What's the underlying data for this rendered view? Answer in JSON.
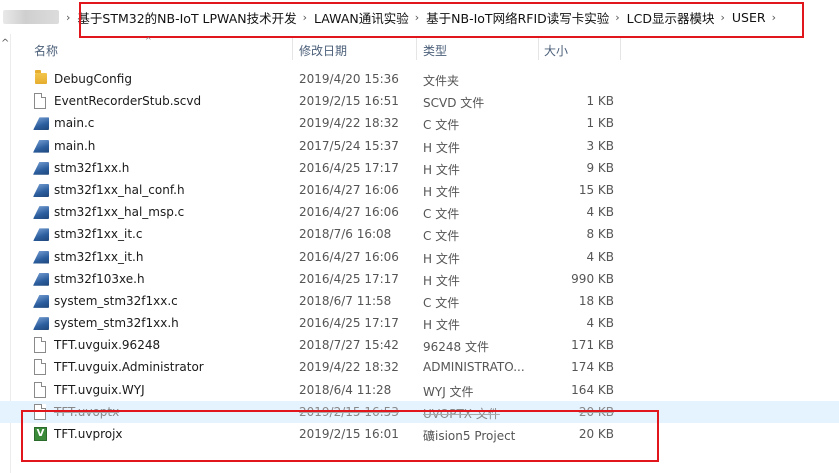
{
  "breadcrumb": {
    "items": [
      "基于STM32的NB-IoT LPWAN技术开发",
      "LAWAN通讯实验",
      "基于NB-IoT网络RFID读写卡实验",
      "LCD显示器模块",
      "USER"
    ],
    "separator": "›"
  },
  "columns": {
    "name": "名称",
    "date": "修改日期",
    "type": "类型",
    "size": "大小"
  },
  "files": [
    {
      "name": "DebugConfig",
      "date": "2019/4/20 15:36",
      "type": "文件夹",
      "size": "",
      "icon": "folder-icon"
    },
    {
      "name": "EventRecorderStub.scvd",
      "date": "2019/2/15 16:51",
      "type": "SCVD 文件",
      "size": "1 KB",
      "icon": "document-icon"
    },
    {
      "name": "main.c",
      "date": "2019/4/22 18:32",
      "type": "C 文件",
      "size": "1 KB",
      "icon": "source-file-icon"
    },
    {
      "name": "main.h",
      "date": "2017/5/24 15:37",
      "type": "H 文件",
      "size": "3 KB",
      "icon": "source-file-icon"
    },
    {
      "name": "stm32f1xx.h",
      "date": "2016/4/25 17:17",
      "type": "H 文件",
      "size": "9 KB",
      "icon": "source-file-icon"
    },
    {
      "name": "stm32f1xx_hal_conf.h",
      "date": "2016/4/27 16:06",
      "type": "H 文件",
      "size": "15 KB",
      "icon": "source-file-icon"
    },
    {
      "name": "stm32f1xx_hal_msp.c",
      "date": "2016/4/27 16:06",
      "type": "C 文件",
      "size": "4 KB",
      "icon": "source-file-icon"
    },
    {
      "name": "stm32f1xx_it.c",
      "date": "2018/7/6 16:08",
      "type": "C 文件",
      "size": "8 KB",
      "icon": "source-file-icon"
    },
    {
      "name": "stm32f1xx_it.h",
      "date": "2016/4/27 16:06",
      "type": "H 文件",
      "size": "4 KB",
      "icon": "source-file-icon"
    },
    {
      "name": "stm32f103xe.h",
      "date": "2016/4/25 17:17",
      "type": "H 文件",
      "size": "990 KB",
      "icon": "source-file-icon"
    },
    {
      "name": "system_stm32f1xx.c",
      "date": "2018/6/7 11:58",
      "type": "C 文件",
      "size": "18 KB",
      "icon": "source-file-icon"
    },
    {
      "name": "system_stm32f1xx.h",
      "date": "2016/4/25 17:17",
      "type": "H 文件",
      "size": "4 KB",
      "icon": "source-file-icon"
    },
    {
      "name": "TFT.uvguix.96248",
      "date": "2018/7/27 15:42",
      "type": "96248 文件",
      "size": "171 KB",
      "icon": "document-icon"
    },
    {
      "name": "TFT.uvguix.Administrator",
      "date": "2019/4/22 18:32",
      "type": "ADMINISTRATO...",
      "size": "174 KB",
      "icon": "document-icon"
    },
    {
      "name": "TFT.uvguix.WYJ",
      "date": "2018/6/4 11:28",
      "type": "WYJ 文件",
      "size": "164 KB",
      "icon": "document-icon"
    },
    {
      "name": "TFT.uvoptx",
      "date": "2019/2/15 16:53",
      "type": "UVOPTX 文件",
      "size": "20 KB",
      "icon": "document-icon"
    },
    {
      "name": "TFT.uvprojx",
      "date": "2019/2/15 16:01",
      "type": "礦ision5 Project",
      "size": "20 KB",
      "icon": "uvision-project-icon"
    }
  ],
  "colors": {
    "highlight": "#e0161c",
    "hover_row": "#e5f3ff",
    "header_text": "#4c607a"
  }
}
